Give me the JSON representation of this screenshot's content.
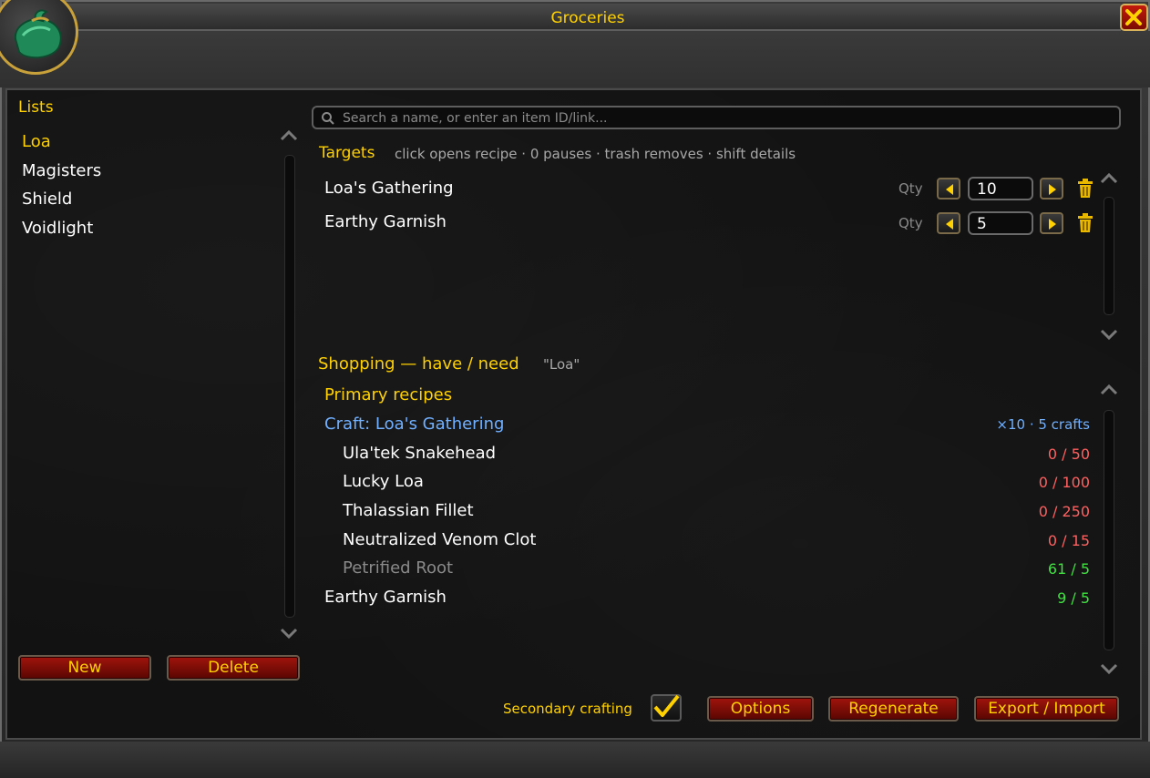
{
  "window": {
    "title": "Groceries"
  },
  "icons": {
    "portrait": "coin-bag-icon",
    "close": "close-icon",
    "search": "search-icon",
    "scroll_up": "chevron-up-icon",
    "scroll_down": "chevron-down-icon",
    "qty_decrease": "arrow-left-icon",
    "qty_increase": "arrow-right-icon",
    "remove": "trash-icon",
    "check": "checkmark-icon"
  },
  "colors": {
    "gold": "#ffd100",
    "need_missing": "#ff6060",
    "need_met": "#40e040",
    "craft_link": "#70b0ff"
  },
  "sidebar": {
    "title": "Lists",
    "items": [
      {
        "label": "Loa",
        "selected": true
      },
      {
        "label": "Magisters",
        "selected": false
      },
      {
        "label": "Shield",
        "selected": false
      },
      {
        "label": "Voidlight",
        "selected": false
      }
    ],
    "new_label": "New",
    "delete_label": "Delete"
  },
  "search": {
    "placeholder": "Search a name, or enter an item ID/link..."
  },
  "targets": {
    "title": "Targets",
    "hint": "click opens recipe · 0 pauses · trash removes · shift details",
    "qty_label": "Qty",
    "rows": [
      {
        "name": "Loa's Gathering",
        "qty": "10"
      },
      {
        "name": "Earthy Garnish",
        "qty": "5"
      }
    ]
  },
  "shopping": {
    "title": "Shopping — have / need",
    "list_name": "\"Loa\"",
    "section_label": "Primary recipes",
    "craft_label": "Craft: Loa's Gathering",
    "craft_info": "×10 · 5 crafts",
    "reagents": [
      {
        "name": "Ula'tek Snakehead",
        "need": "0 / 50",
        "met": false,
        "dim": false
      },
      {
        "name": "Lucky Loa",
        "need": "0 / 100",
        "met": false,
        "dim": false
      },
      {
        "name": "Thalassian Fillet",
        "need": "0 / 250",
        "met": false,
        "dim": false
      },
      {
        "name": "Neutralized Venom Clot",
        "need": "0 / 15",
        "met": false,
        "dim": false
      },
      {
        "name": "Petrified Root",
        "need": "61 / 5",
        "met": true,
        "dim": true
      }
    ],
    "extra_name": "Earthy Garnish",
    "extra_need": "9 / 5"
  },
  "footer": {
    "secondary_label": "Secondary crafting",
    "secondary_checked": true,
    "options_label": "Options",
    "regenerate_label": "Regenerate",
    "export_label": "Export / Import"
  }
}
